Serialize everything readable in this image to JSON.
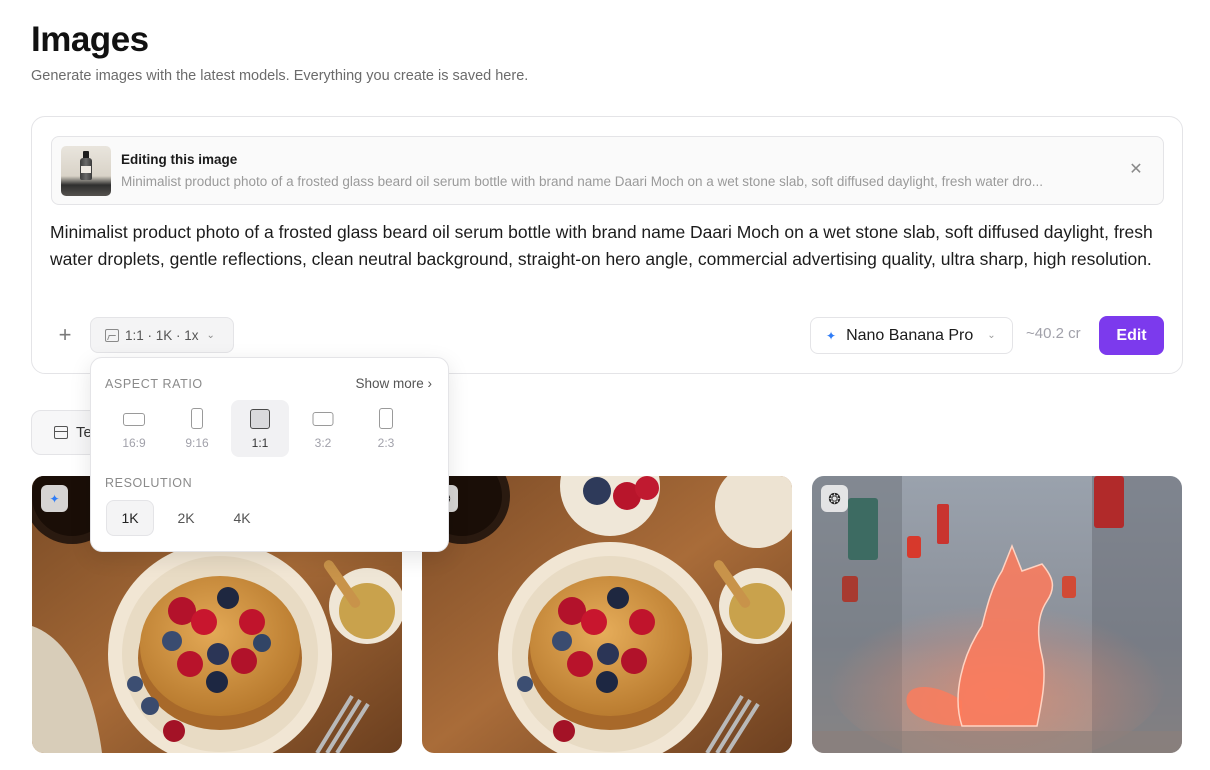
{
  "page": {
    "title": "Images",
    "subtitle": "Generate images with the latest models. Everything you create is saved here."
  },
  "editing": {
    "heading": "Editing this image",
    "description": "Minimalist product photo of a frosted glass beard oil serum bottle with brand name Daari Moch on a wet stone slab, soft diffused daylight, fresh water dro...",
    "close_icon": "close-icon"
  },
  "prompt": {
    "text": "Minimalist product photo of a frosted glass beard oil serum bottle with brand name Daari Moch on a wet stone slab, soft diffused daylight, fresh water droplets, gentle reflections, clean neutral background, straight-on hero angle, commercial advertising quality, ultra sharp, high resolution."
  },
  "toolbar": {
    "add_label": "+",
    "settings_label": "1:1 · 1K · 1x",
    "model_label": "Nano Banana Pro",
    "cost_label": "~40.2 cr",
    "edit_label": "Edit"
  },
  "templates_chip": {
    "label": "Te"
  },
  "dropdown": {
    "aspect_ratio_heading": "ASPECT RATIO",
    "show_more": "Show more ›",
    "aspect_ratios": [
      {
        "label": "16:9",
        "selected": false
      },
      {
        "label": "9:16",
        "selected": false
      },
      {
        "label": "1:1",
        "selected": true
      },
      {
        "label": "3:2",
        "selected": false
      },
      {
        "label": "2:3",
        "selected": false
      }
    ],
    "resolution_heading": "RESOLUTION",
    "resolutions": [
      {
        "label": "1K",
        "selected": true
      },
      {
        "label": "2K",
        "selected": false
      },
      {
        "label": "4K",
        "selected": false
      }
    ]
  },
  "gallery": [
    {
      "badge_icon": "sparkle-icon",
      "subject": "pancakes-with-berries"
    },
    {
      "badge_icon": "openai-icon",
      "subject": "pancakes-with-berries"
    },
    {
      "badge_icon": "openai-icon",
      "subject": "neon-fox-in-alley"
    }
  ],
  "colors": {
    "accent": "#7c3aed",
    "model_sparkle": "#2f7cf6"
  }
}
